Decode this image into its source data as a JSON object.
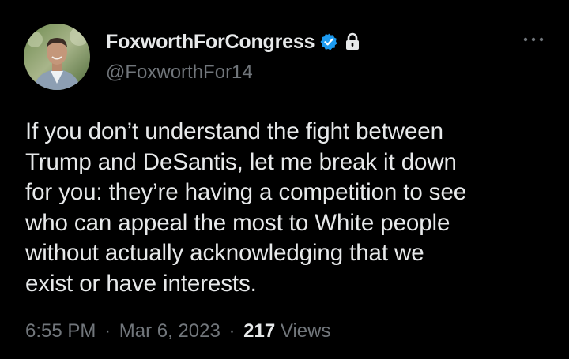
{
  "tweet": {
    "display_name": "FoxworthForCongress",
    "handle": "@FoxworthFor14",
    "text": "If you don’t understand the fight between\nTrump and DeSantis, let me break it down\nfor you: they’re having a competition to see\nwho can appeal the most to White people\nwithout actually acknowledging that we\nexist or have interests.",
    "time": "6:55 PM",
    "date": "Mar 6, 2023",
    "separator": "·",
    "views_count": "217",
    "views_label": "Views"
  },
  "icons": {
    "verified": "verified-badge-icon",
    "protected": "lock-icon",
    "more": "more-options-icon"
  },
  "colors": {
    "background": "#000000",
    "primary_text": "#e7e9ea",
    "secondary_text": "#71767b",
    "verified_blue": "#1d9bf0"
  }
}
